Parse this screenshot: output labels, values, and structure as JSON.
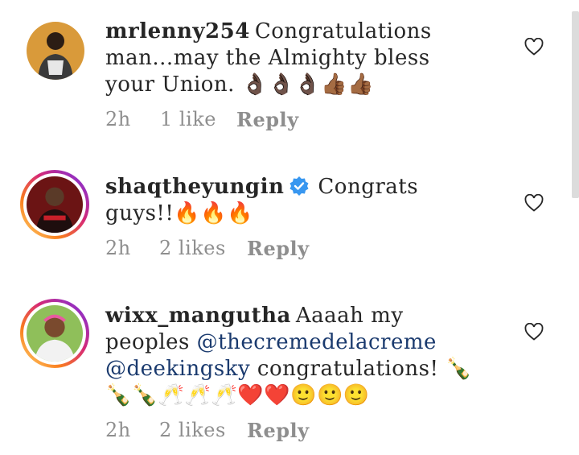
{
  "comments": [
    {
      "username": "mrlenny254",
      "text": "Congratulations man...may the Almighty bless your Union. 👌🏿👌🏿👌🏿👍🏾👍🏾",
      "time": "2h",
      "likes": "1 like",
      "reply": "Reply",
      "verified": false,
      "story_ring": false
    },
    {
      "username": "shaqtheyungin",
      "text": "Congrats guys!!🔥🔥🔥",
      "time": "2h",
      "likes": "2 likes",
      "reply": "Reply",
      "verified": true,
      "story_ring": true
    },
    {
      "username": "wixx_mangutha",
      "text_before": "Aaaah my peoples ",
      "mention1": "@thecremedelacreme",
      "mention2": "@deekingsky",
      "text_after": " congratulations! 🍾🍾🍾🥂🥂🥂❤️❤️🙂🙂🙂",
      "time": "2h",
      "likes": "2 likes",
      "reply": "Reply",
      "verified": false,
      "story_ring": true
    }
  ],
  "colors": {
    "text": "#262626",
    "meta": "#8e8e8e",
    "mention": "#1a3a6e",
    "verified": "#3897f0"
  },
  "icons": [
    "heart-outline-icon",
    "verified-badge-icon"
  ]
}
